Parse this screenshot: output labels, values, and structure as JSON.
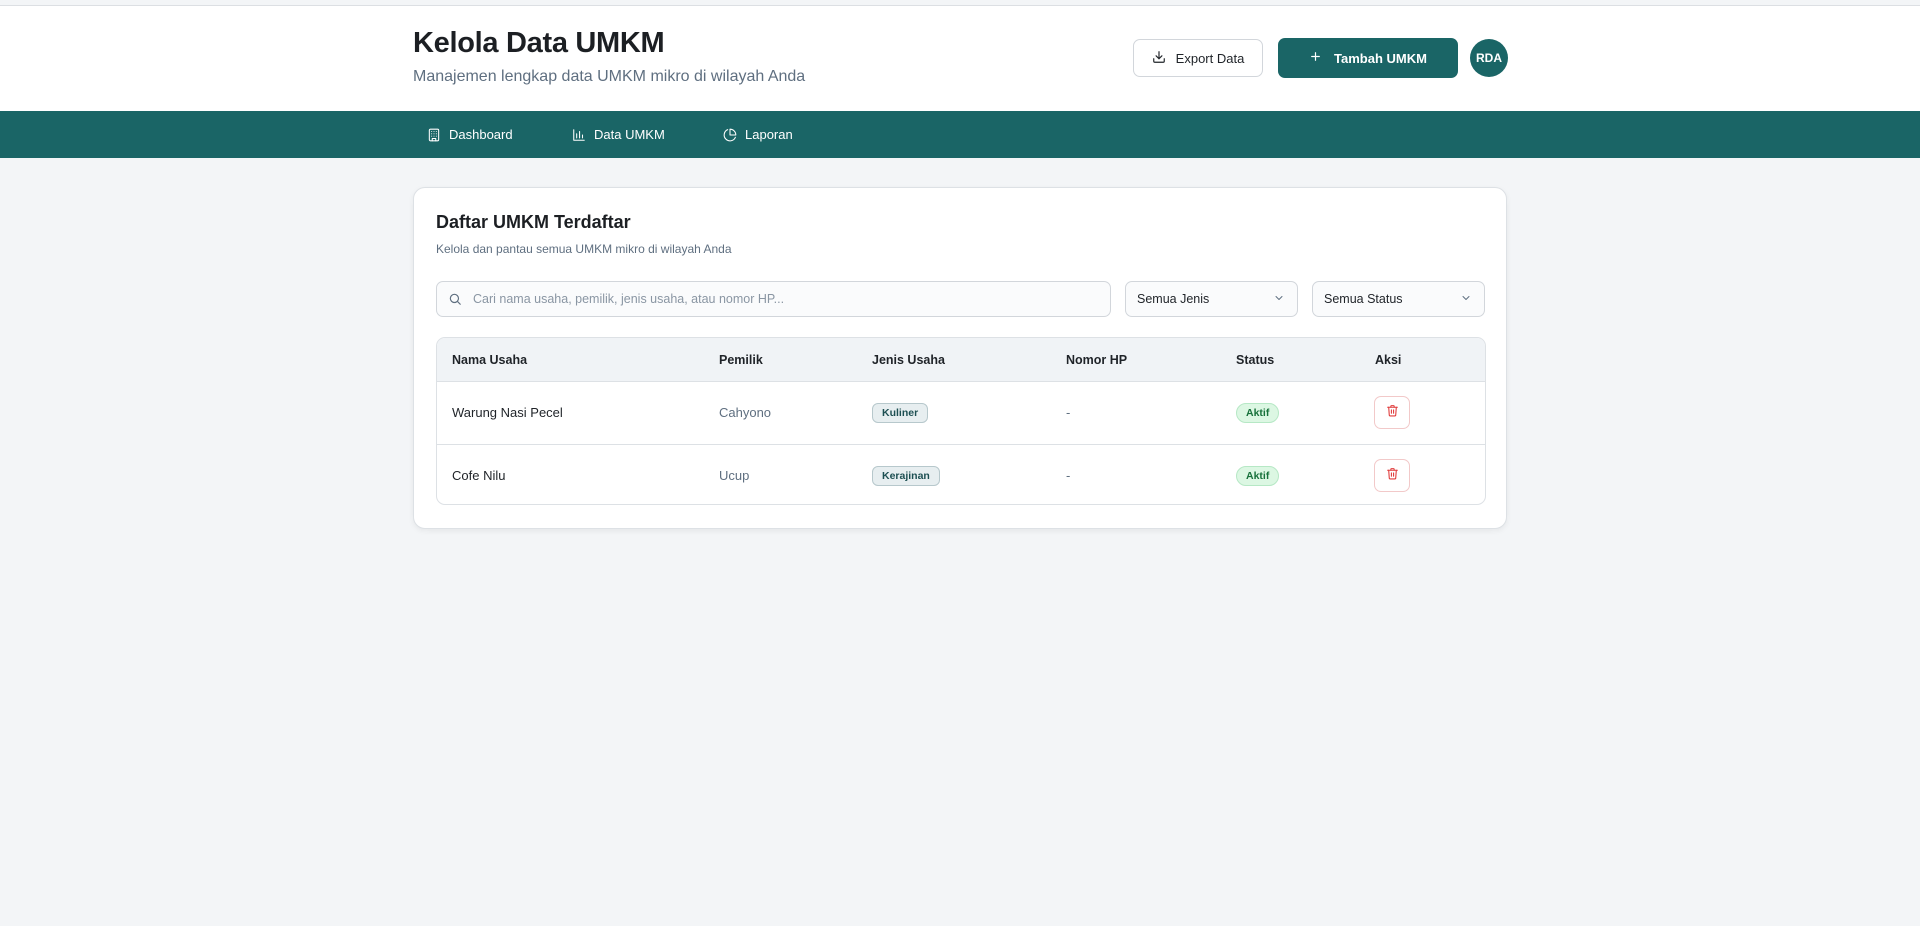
{
  "header": {
    "title": "Kelola Data UMKM",
    "subtitle": "Manajemen lengkap data UMKM mikro di wilayah Anda",
    "export_label": "Export Data",
    "add_label": "Tambah UMKM",
    "avatar_initials": "RDA"
  },
  "nav": {
    "items": [
      {
        "label": "Dashboard",
        "icon": "building-icon"
      },
      {
        "label": "Data UMKM",
        "icon": "bar-chart-icon"
      },
      {
        "label": "Laporan",
        "icon": "pie-chart-icon"
      }
    ]
  },
  "card": {
    "title": "Daftar UMKM Terdaftar",
    "subtitle": "Kelola dan pantau semua UMKM mikro di wilayah Anda",
    "search_placeholder": "Cari nama usaha, pemilik, jenis usaha, atau nomor HP...",
    "filter_type_value": "Semua Jenis",
    "filter_status_value": "Semua Status"
  },
  "table": {
    "columns": [
      "Nama Usaha",
      "Pemilik",
      "Jenis Usaha",
      "Nomor HP",
      "Status",
      "Aksi"
    ],
    "rows": [
      {
        "name": "Warung Nasi Pecel",
        "owner": "Cahyono",
        "type": "Kuliner",
        "phone": "-",
        "status": "Aktif"
      },
      {
        "name": "Cofe Nilu",
        "owner": "Ucup",
        "type": "Kerajinan",
        "phone": "-",
        "status": "Aktif"
      }
    ]
  },
  "colors": {
    "primary": "#1a6566",
    "background": "#f3f5f7",
    "status_active_bg": "#dcf7e3",
    "status_active_text": "#17713b",
    "delete_icon": "#e03b3b"
  }
}
